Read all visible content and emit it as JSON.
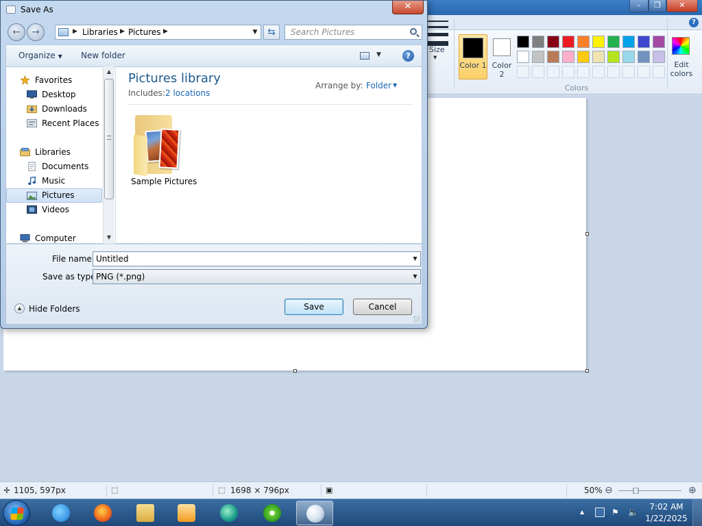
{
  "dialog": {
    "title": "Save As",
    "address": {
      "segments": [
        "Libraries",
        "Pictures"
      ]
    },
    "search": {
      "placeholder": "Search Pictures"
    },
    "toolbar": {
      "organize": "Organize",
      "new_folder": "New folder"
    },
    "nav": {
      "favorites": "Favorites",
      "desktop": "Desktop",
      "downloads": "Downloads",
      "recent_places": "Recent Places",
      "libraries": "Libraries",
      "documents": "Documents",
      "music": "Music",
      "pictures": "Pictures",
      "videos": "Videos",
      "computer": "Computer",
      "selected": "Pictures"
    },
    "content": {
      "title": "Pictures library",
      "includes_label": "Includes:",
      "includes_link": "2 locations",
      "arrange_label": "Arrange by:",
      "arrange_value": "Folder",
      "items": [
        {
          "name": "Sample Pictures"
        }
      ]
    },
    "form": {
      "file_name_label": "File name:",
      "file_name_value": "Untitled",
      "save_type_label": "Save as type:",
      "save_type_value": "PNG (*.png)",
      "hide_folders": "Hide Folders",
      "save_button": "Save",
      "cancel_button": "Cancel"
    }
  },
  "paint": {
    "size_label": "Size",
    "color1_label": "Color 1",
    "color2_label": "Color 2",
    "colors_group_label": "Colors",
    "edit_colors_label": "Edit colors",
    "color1": "#000000",
    "color2": "#ffffff",
    "palette_row1": [
      "#000000",
      "#7f7f7f",
      "#880015",
      "#ed1c24",
      "#ff7f27",
      "#fff200",
      "#22b14c",
      "#00a2e8",
      "#3f48cc",
      "#a349a4"
    ],
    "palette_row2": [
      "#ffffff",
      "#c3c3c3",
      "#b97a57",
      "#ffaec9",
      "#ffc90e",
      "#efe4b0",
      "#b5e61d",
      "#99d9ea",
      "#7092be",
      "#c8bfe7"
    ],
    "status": {
      "cursor_pos": "1105, 597px",
      "image_size": "1698 × 796px",
      "zoom": "50%"
    }
  },
  "taskbar": {
    "apps": [
      "internet-explorer-icon",
      "firefox-icon",
      "file-explorer-icon",
      "media-player-icon",
      "photos-icon",
      "media-center-icon",
      "paint-icon"
    ],
    "clock_time": "7:02 AM",
    "clock_date": "1/22/2025"
  }
}
